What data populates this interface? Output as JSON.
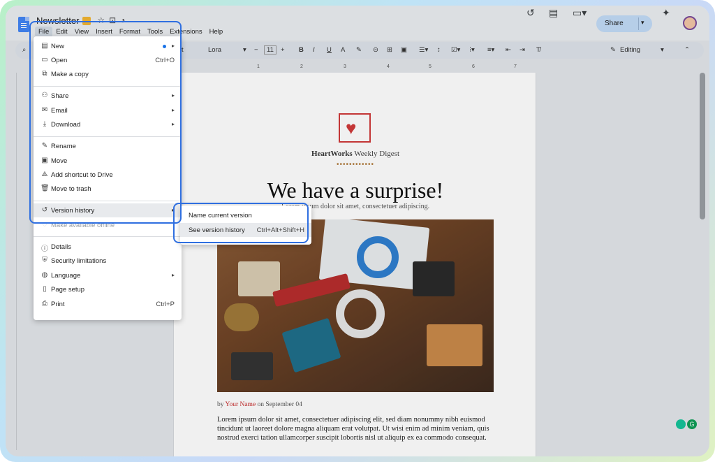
{
  "doc": {
    "title": "Newsletter"
  },
  "menubar": [
    "File",
    "Edit",
    "View",
    "Insert",
    "Format",
    "Tools",
    "Extensions",
    "Help"
  ],
  "header": {
    "share_label": "Share"
  },
  "toolbar": {
    "style": "est",
    "font": "Lora",
    "font_size": "11",
    "mode": "Editing"
  },
  "ruler": [
    "1",
    "2",
    "3",
    "4",
    "5",
    "6",
    "7"
  ],
  "file_menu": {
    "items": [
      {
        "label": "New",
        "icon": "new-doc-icon",
        "shortcut": "",
        "submenu": true
      },
      {
        "label": "Open",
        "icon": "folder-icon",
        "shortcut": "Ctrl+O",
        "submenu": false
      },
      {
        "label": "Make a copy",
        "icon": "copy-icon",
        "shortcut": "",
        "submenu": false
      },
      {
        "label": "Share",
        "icon": "person-add-icon",
        "shortcut": "",
        "submenu": true
      },
      {
        "label": "Email",
        "icon": "mail-icon",
        "shortcut": "",
        "submenu": true
      },
      {
        "label": "Download",
        "icon": "download-icon",
        "shortcut": "",
        "submenu": true
      },
      {
        "label": "Rename",
        "icon": "pencil-icon",
        "shortcut": "",
        "submenu": false
      },
      {
        "label": "Move",
        "icon": "move-folder-icon",
        "shortcut": "",
        "submenu": false
      },
      {
        "label": "Add shortcut to Drive",
        "icon": "drive-shortcut-icon",
        "shortcut": "",
        "submenu": false
      },
      {
        "label": "Move to trash",
        "icon": "trash-icon",
        "shortcut": "",
        "submenu": false
      },
      {
        "label": "Version history",
        "icon": "history-icon",
        "shortcut": "",
        "submenu": true
      },
      {
        "label": "Make available offline",
        "icon": "offline-icon",
        "shortcut": "",
        "submenu": false
      },
      {
        "label": "Details",
        "icon": "info-icon",
        "shortcut": "",
        "submenu": false
      },
      {
        "label": "Security limitations",
        "icon": "security-icon",
        "shortcut": "",
        "submenu": false
      },
      {
        "label": "Language",
        "icon": "globe-icon",
        "shortcut": "",
        "submenu": true
      },
      {
        "label": "Page setup",
        "icon": "page-setup-icon",
        "shortcut": "",
        "submenu": false
      },
      {
        "label": "Print",
        "icon": "print-icon",
        "shortcut": "Ctrl+P",
        "submenu": false
      }
    ]
  },
  "version_submenu": {
    "items": [
      {
        "label": "Name current version",
        "shortcut": ""
      },
      {
        "label": "See version history",
        "shortcut": "Ctrl+Alt+Shift+H"
      }
    ]
  },
  "page": {
    "brand_bold": "HeartWorks",
    "brand_rest": " Weekly Digest",
    "dots": "••••••••••••",
    "headline": "We have a surprise!",
    "subheadline": "Lorem ipsum dolor sit amet, consectetuer adipiscing.",
    "byline_prefix": "by ",
    "byline_name": "Your Name",
    "byline_suffix": " on September 04",
    "body": "Lorem ipsum dolor sit amet, consectetuer adipiscing elit, sed diam nonummy nibh euismod tincidunt ut laoreet dolore magna aliquam erat volutpat. Ut wisi enim ad minim veniam, quis nostrud exerci tation ullamcorper suscipit lobortis nisl ut aliquip ex ea commodo consequat."
  },
  "colors": {
    "accent": "#2f6fe0",
    "brand_red": "#d03a3a",
    "share_bg": "#c2dbf7"
  }
}
